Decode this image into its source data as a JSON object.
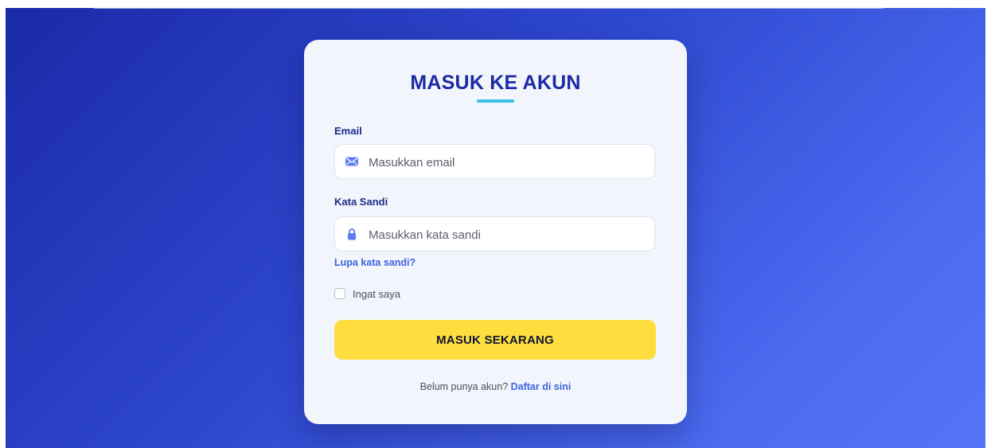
{
  "colors": {
    "background_gradient": [
      "#1a2aa8",
      "#5575f7"
    ],
    "card": "#f2f5fb",
    "title": "#1b2ba3",
    "accent_underline": "#39c2e6",
    "link": "#3d63e0",
    "button": "#fedd3f"
  },
  "login": {
    "title": "MASUK KE AKUN",
    "email": {
      "label": "Email",
      "placeholder": "Masukkan email",
      "value": "",
      "icon": "envelope-icon"
    },
    "password": {
      "label": "Kata Sandi",
      "placeholder": "Masukkan kata sandi",
      "value": "",
      "icon": "lock-icon"
    },
    "forgot_link": "Lupa kata sandi?",
    "remember": {
      "label": "Ingat saya",
      "checked": false
    },
    "submit_label": "MASUK SEKARANG",
    "signup_prompt": "Belum punya akun?",
    "signup_link": "Daftar di sini"
  }
}
